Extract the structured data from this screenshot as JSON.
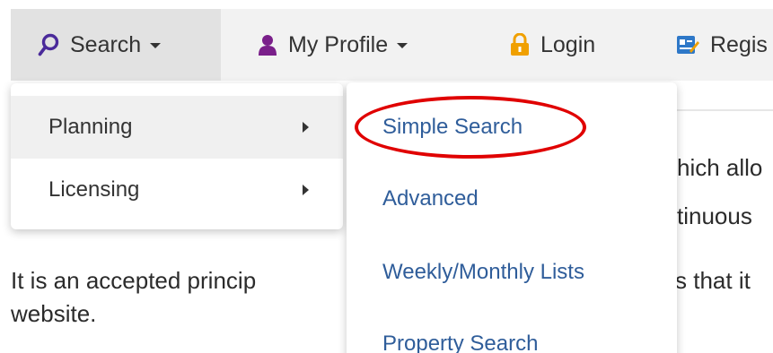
{
  "nav": {
    "search_label": "Search",
    "profile_label": "My Profile",
    "login_label": "Login",
    "register_label": "Regis"
  },
  "search_menu": {
    "items": [
      {
        "label": "Planning"
      },
      {
        "label": "Licensing"
      }
    ]
  },
  "planning_submenu": {
    "items": [
      {
        "label": "Simple Search"
      },
      {
        "label": "Advanced"
      },
      {
        "label": "Weekly/Monthly Lists"
      },
      {
        "label": "Property Search"
      }
    ]
  },
  "content": {
    "frag_1": "hich allo",
    "frag_2": "tinuous",
    "line_1_start": "It is an accepted princip",
    "line_1_end": "s that it",
    "line_2": "website."
  },
  "colors": {
    "search_icon": "#4a2a9a",
    "profile_icon": "#7a1f8a",
    "login_icon": "#f0a000",
    "register_icon": "#2e78c8",
    "link": "#2f5d9a",
    "highlight": "#e00000"
  },
  "icons": {
    "search": "search-icon",
    "profile": "user-icon",
    "login": "lock-icon",
    "register": "register-icon"
  }
}
